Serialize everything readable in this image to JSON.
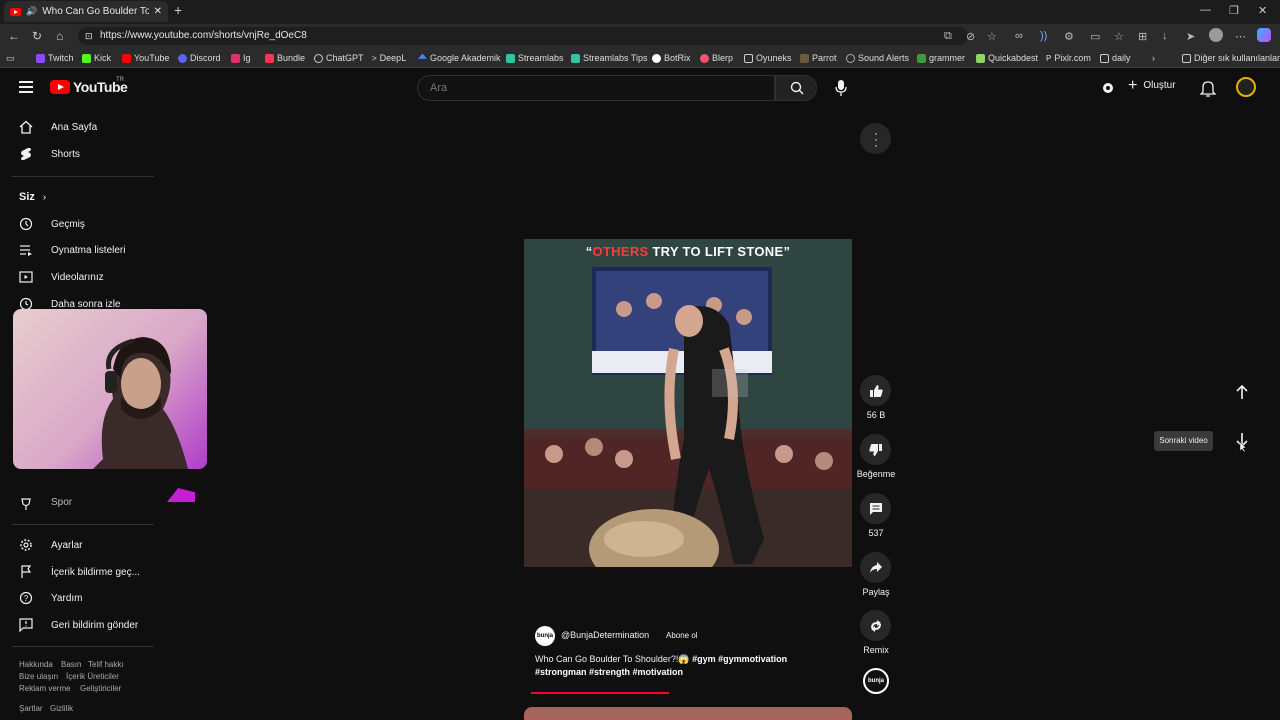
{
  "browser": {
    "tab_title": "Who Can Go Boulder To Sho",
    "url": "https://www.youtube.com/shorts/vnjRe_dOeC8",
    "bookmarks": [
      "Twitch",
      "Kick",
      "YouTube",
      "Discord",
      "Ig",
      "Bundle",
      "ChatGPT",
      "DeepL",
      "Google Akademik",
      "Streamlabs",
      "Streamlabs Tips",
      "BotRix",
      "Blerp",
      "Oyuneks",
      "Parrot",
      "Sound Alerts",
      "grammer",
      "Quickabdest",
      "Pixlr.com",
      "daily"
    ],
    "other_bookmarks": "Diğer sık kullanılanlar"
  },
  "header": {
    "logo_text": "YouTube",
    "logo_region": "TR",
    "search_placeholder": "Ara",
    "create_label": "Oluştur"
  },
  "sidebar": {
    "top_items": [
      {
        "label": "Ana Sayfa",
        "icon": "home-icon"
      },
      {
        "label": "Shorts",
        "icon": "shorts-icon"
      }
    ],
    "you_heading": "Siz",
    "you_items": [
      {
        "label": "Geçmiş",
        "icon": "history-icon"
      },
      {
        "label": "Oynatma listeleri",
        "icon": "playlist-icon"
      },
      {
        "label": "Videolarınız",
        "icon": "your-videos-icon"
      },
      {
        "label": "Daha sonra izle",
        "icon": "watch-later-icon"
      }
    ],
    "partial_item": "Spor",
    "bottom_items": [
      {
        "label": "Ayarlar",
        "icon": "gear-icon"
      },
      {
        "label": "İçerik bildirme geç...",
        "icon": "flag-icon"
      },
      {
        "label": "Yardım",
        "icon": "help-icon"
      },
      {
        "label": "Geri bildirim gönder",
        "icon": "feedback-icon"
      }
    ],
    "footer_row1": [
      "Hakkında",
      "Basın",
      "Telif hakkı"
    ],
    "footer_row2": [
      "Bize ulaşın",
      "İçerik Üreticiler"
    ],
    "footer_row3": [
      "Reklam verme",
      "Geliştiriciler"
    ],
    "footer_row4": [
      "Şartlar",
      "Gizlilik"
    ]
  },
  "short": {
    "overlay_title_red": "OTHERS",
    "overlay_title_white": " TRY TO LIFT STONE",
    "open_quote": "“",
    "close_quote": "”",
    "like_count": "56 B",
    "dislike_label": "Beğenme",
    "comment_count": "537",
    "share_label": "Paylaş",
    "remix_label": "Remix",
    "channel_avatar_text": "bunja",
    "channel_name": "@BunjaDetermination",
    "subscribe_label": "Abone ol",
    "caption_text": "Who Can Go Boulder To Shoulder?!😱 ",
    "hashtags_line1": "#gym #gymmotivation",
    "hashtags_line2": "#strongman #strength #motivation",
    "progress": 0.42
  },
  "nav": {
    "next_tooltip": "Sonraki video"
  },
  "colors": {
    "background": "#0f0f0f",
    "accent_red": "#ff0033",
    "avatar_ring": "#e4b200"
  }
}
